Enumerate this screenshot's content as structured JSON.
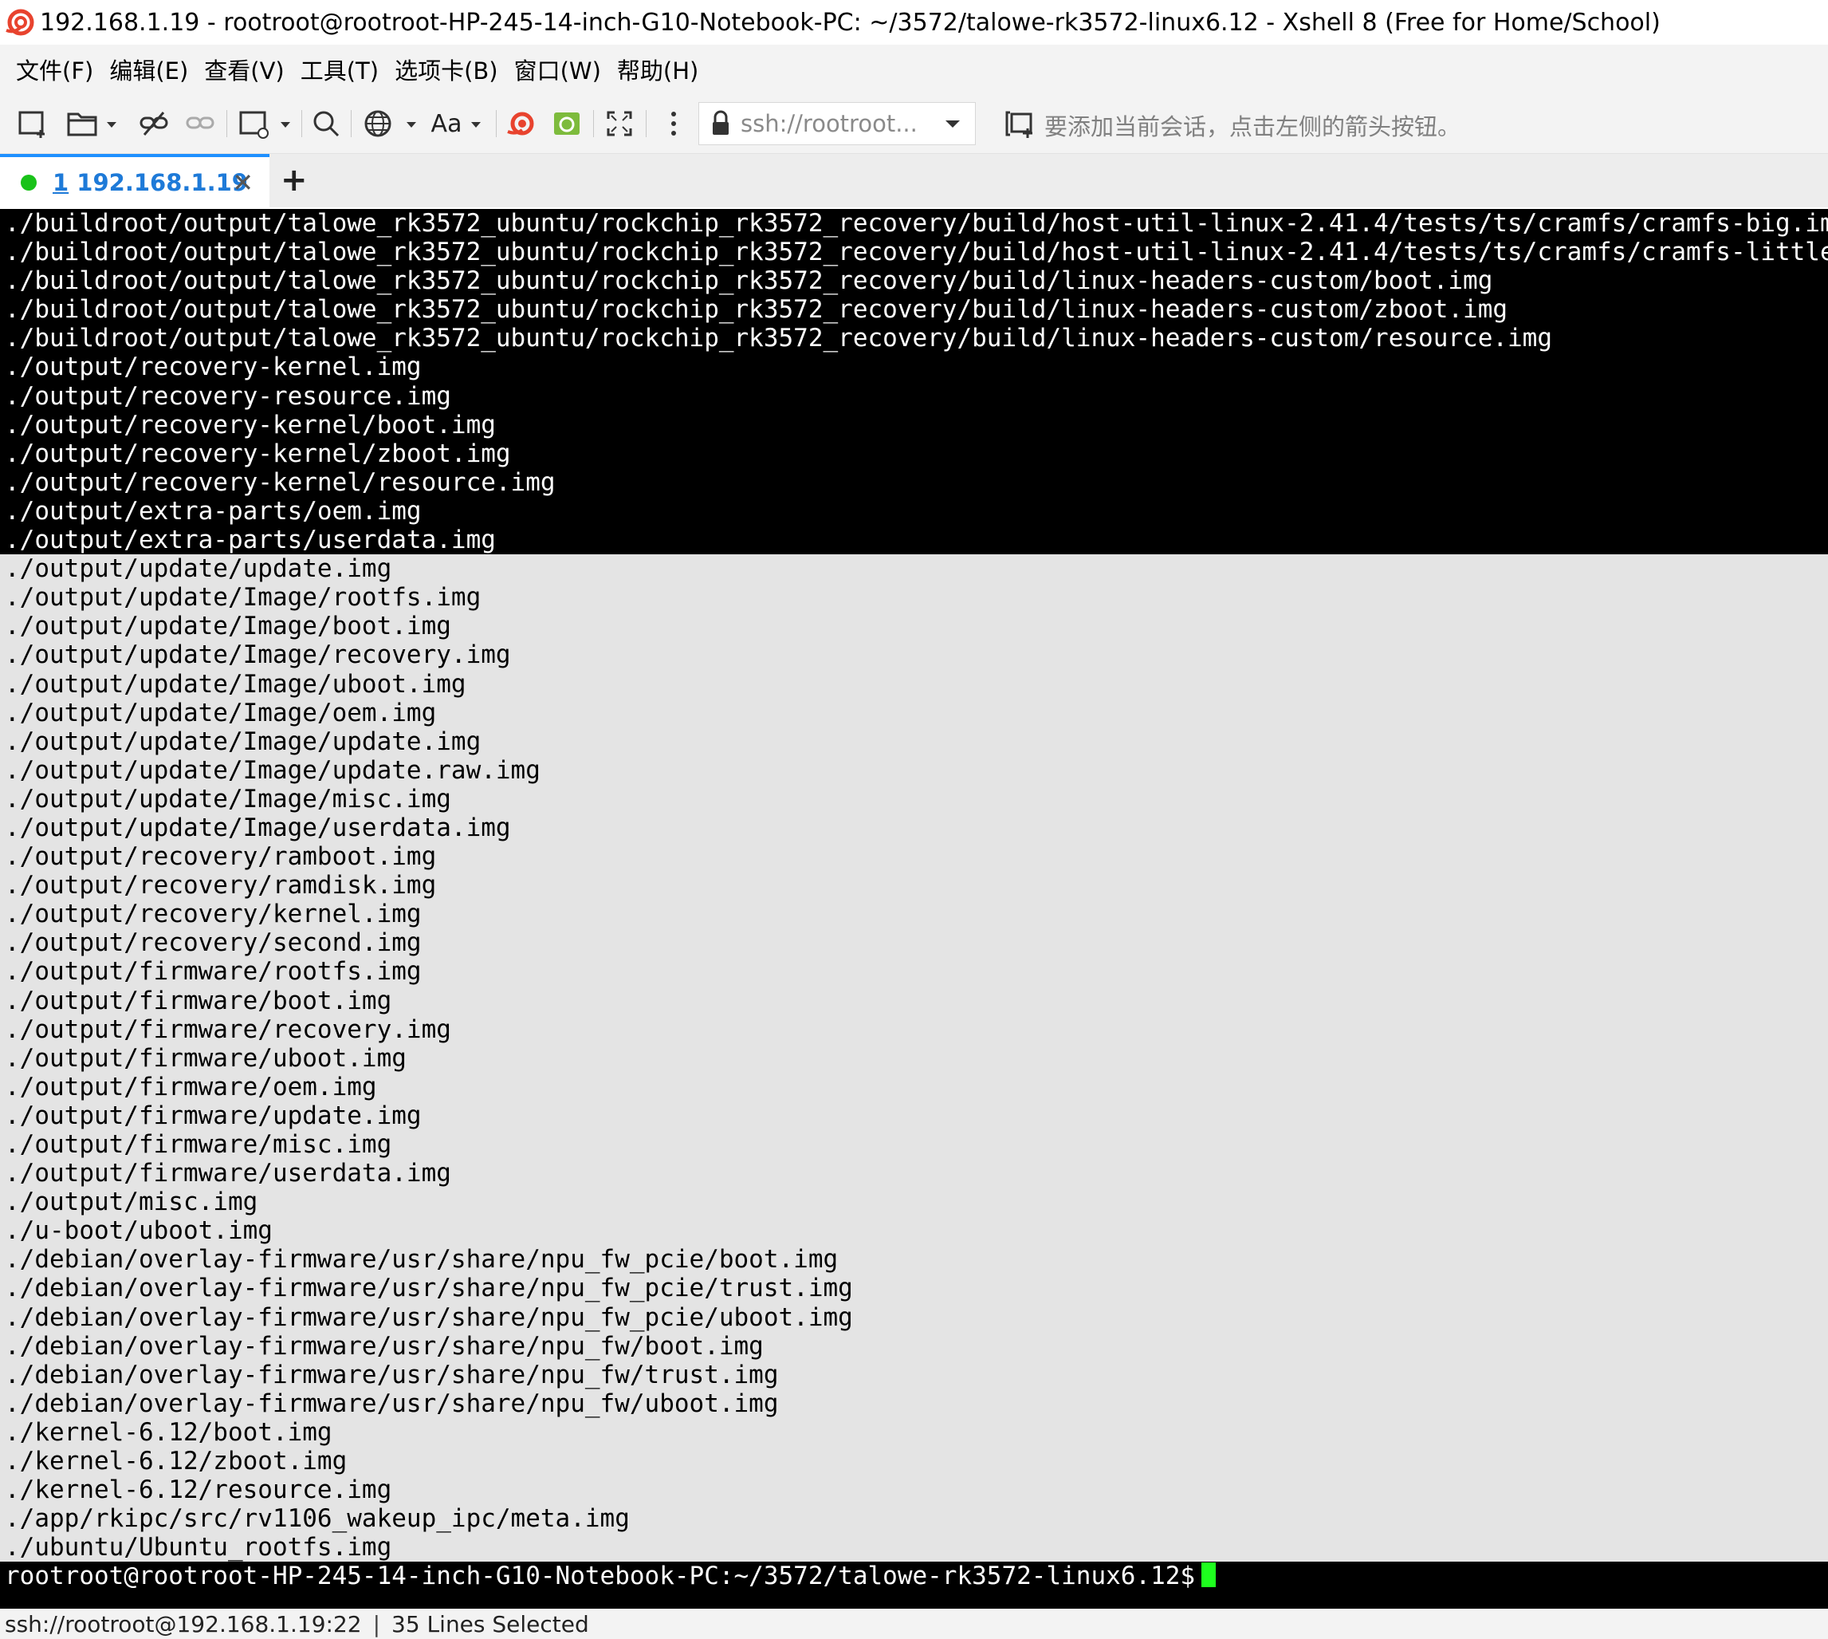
{
  "window": {
    "title": "192.168.1.19 - rootroot@rootroot-HP-245-14-inch-G10-Notebook-PC: ~/3572/talowe-rk3572-linux6.12 - Xshell 8 (Free for Home/School)"
  },
  "menu": {
    "items": [
      "文件(F)",
      "编辑(E)",
      "查看(V)",
      "工具(T)",
      "选项卡(B)",
      "窗口(W)",
      "帮助(H)"
    ]
  },
  "toolbar": {
    "address": "ssh://rootroot...",
    "font_label": "Aa",
    "hint": "要添加当前会话，点击左侧的箭头按钮。"
  },
  "tab": {
    "number": "1",
    "host": "192.168.1.19",
    "close": "✕",
    "add": "+"
  },
  "terminal": {
    "lines": [
      "./buildroot/output/talowe_rk3572_ubuntu/rockchip_rk3572_recovery/build/host-util-linux-2.41.4/tests/ts/cramfs/cramfs-big.img",
      "./buildroot/output/talowe_rk3572_ubuntu/rockchip_rk3572_recovery/build/host-util-linux-2.41.4/tests/ts/cramfs/cramfs-little.img",
      "./buildroot/output/talowe_rk3572_ubuntu/rockchip_rk3572_recovery/build/linux-headers-custom/boot.img",
      "./buildroot/output/talowe_rk3572_ubuntu/rockchip_rk3572_recovery/build/linux-headers-custom/zboot.img",
      "./buildroot/output/talowe_rk3572_ubuntu/rockchip_rk3572_recovery/build/linux-headers-custom/resource.img",
      "./output/recovery-kernel.img",
      "./output/recovery-resource.img",
      "./output/recovery-kernel/boot.img",
      "./output/recovery-kernel/zboot.img",
      "./output/recovery-kernel/resource.img",
      "./output/extra-parts/oem.img",
      "./output/extra-parts/userdata.img"
    ],
    "selected_lines": [
      "./output/update/update.img",
      "./output/update/Image/rootfs.img",
      "./output/update/Image/boot.img",
      "./output/update/Image/recovery.img",
      "./output/update/Image/uboot.img",
      "./output/update/Image/oem.img",
      "./output/update/Image/update.img",
      "./output/update/Image/update.raw.img",
      "./output/update/Image/misc.img",
      "./output/update/Image/userdata.img",
      "./output/recovery/ramboot.img",
      "./output/recovery/ramdisk.img",
      "./output/recovery/kernel.img",
      "./output/recovery/second.img",
      "./output/firmware/rootfs.img",
      "./output/firmware/boot.img",
      "./output/firmware/recovery.img",
      "./output/firmware/uboot.img",
      "./output/firmware/oem.img",
      "./output/firmware/update.img",
      "./output/firmware/misc.img",
      "./output/firmware/userdata.img",
      "./output/misc.img",
      "./u-boot/uboot.img",
      "./debian/overlay-firmware/usr/share/npu_fw_pcie/boot.img",
      "./debian/overlay-firmware/usr/share/npu_fw_pcie/trust.img",
      "./debian/overlay-firmware/usr/share/npu_fw_pcie/uboot.img",
      "./debian/overlay-firmware/usr/share/npu_fw/boot.img",
      "./debian/overlay-firmware/usr/share/npu_fw/trust.img",
      "./debian/overlay-firmware/usr/share/npu_fw/uboot.img",
      "./kernel-6.12/boot.img",
      "./kernel-6.12/zboot.img",
      "./kernel-6.12/resource.img",
      "./app/rkipc/src/rv1106_wakeup_ipc/meta.img",
      "./ubuntu/Ubuntu_rootfs.img"
    ],
    "prompt": "rootroot@rootroot-HP-245-14-inch-G10-Notebook-PC:~/3572/talowe-rk3572-linux6.12$"
  },
  "status": {
    "connection": "ssh://rootroot@192.168.1.19:22",
    "separator": "|",
    "selection": "35 Lines Selected"
  },
  "colors": {
    "terminal_bg": "#000000",
    "terminal_fg": "#ffffff",
    "selection_bg": "#e4e4e4",
    "cursor": "#1eff1e",
    "tab_accent": "#1e7ad8",
    "status_dot": "#19c219"
  },
  "icons": [
    "xshell-logo-icon",
    "new-session-icon",
    "open-folder-icon",
    "disconnect-icon",
    "reconnect-icon",
    "new-window-icon",
    "search-icon",
    "globe-icon",
    "font-icon",
    "xshell-icon",
    "xftp-icon",
    "fullscreen-icon",
    "more-icon",
    "lock-icon",
    "add-session-icon"
  ]
}
